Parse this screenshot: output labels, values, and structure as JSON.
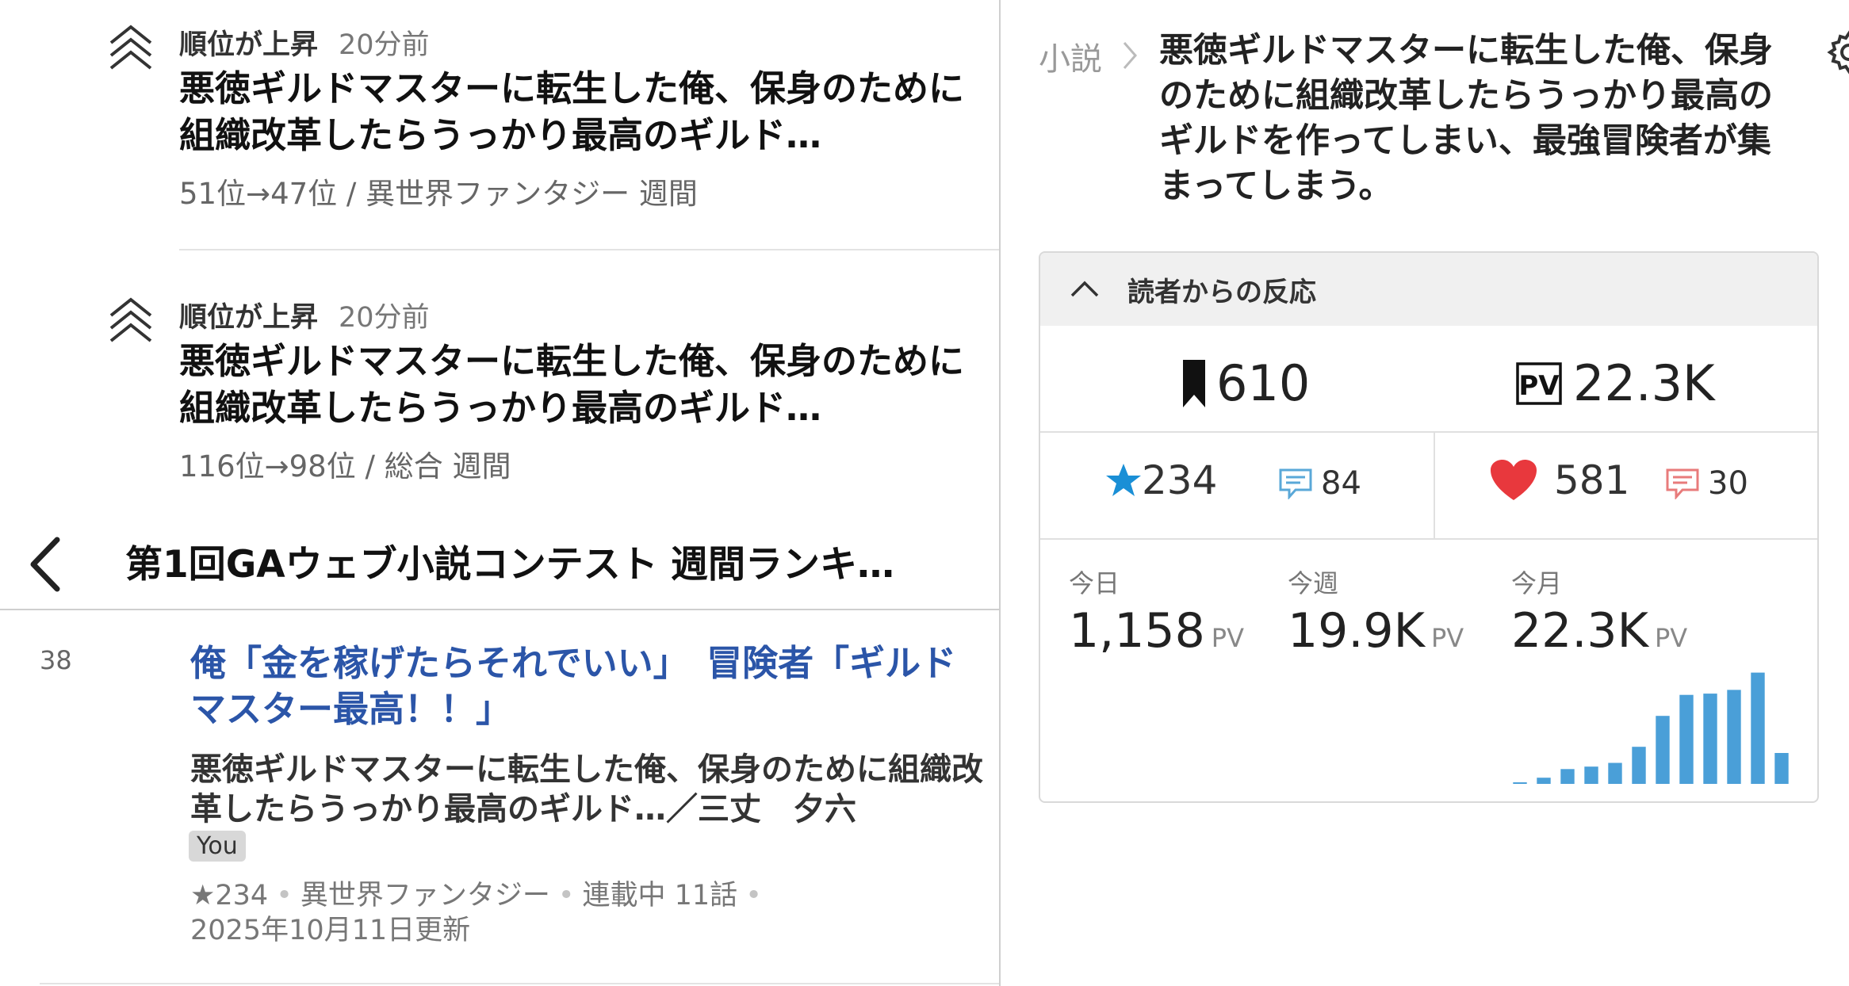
{
  "notifications": [
    {
      "kind": "順位が上昇",
      "time": "20分前",
      "title": "悪徳ギルドマスターに転生した俺、保身のために組織改革したらうっかり最高のギルド…",
      "detail": "51位→47位 / 異世界ファンタジー 週間"
    },
    {
      "kind": "順位が上昇",
      "time": "20分前",
      "title": "悪徳ギルドマスターに転生した俺、保身のために組織改革したらうっかり最高のギルド…",
      "detail": "116位→98位 / 総合 週間"
    }
  ],
  "contest": {
    "title": "第1回GAウェブ小説コンテスト 週間ランキ…"
  },
  "entry": {
    "rank": "38",
    "catchphrase": "俺「金を稼げたらそれでいい」　冒険者「ギルドマスター最高！！」",
    "description": "悪徳ギルドマスターに転生した俺、保身のために組織改革したらうっかり最高のギルド…／三丈　夕六",
    "badge": "You",
    "stars": "★234",
    "genre": "異世界ファンタジー",
    "status": "連載中 11話",
    "updated": "2025年10月11日更新"
  },
  "detail": {
    "breadcrumb": "小説",
    "title": "悪徳ギルドマスターに転生した俺、保身のために組織改革したらうっかり最高のギルドを作ってしまい、最強冒険者が集まってしまう。"
  },
  "reactions": {
    "header": "読者からの反応",
    "bookmarks": "610",
    "pv_total": "22.3K",
    "stars": "234",
    "reviews": "84",
    "hearts": "581",
    "comments": "30",
    "today_label": "今日",
    "today_value": "1,158",
    "week_label": "今週",
    "week_value": "19.9K",
    "month_label": "今月",
    "month_value": "22.3K",
    "pv_unit": "PV",
    "colors": {
      "star": "#1a8fd6",
      "heart": "#e8383d",
      "review_icon": "#5aa8d8",
      "comment_icon": "#e87b7b",
      "bar": "#4a9fd8"
    }
  },
  "chart_data": {
    "type": "bar",
    "categories": [
      "",
      "",
      "",
      "",
      "",
      "",
      "",
      "",
      "",
      "",
      "",
      ""
    ],
    "values": [
      1,
      5,
      12,
      14,
      17,
      30,
      55,
      72,
      73,
      76,
      90,
      25
    ],
    "ylim": [
      0,
      100
    ],
    "title": "",
    "xlabel": "",
    "ylabel": ""
  }
}
